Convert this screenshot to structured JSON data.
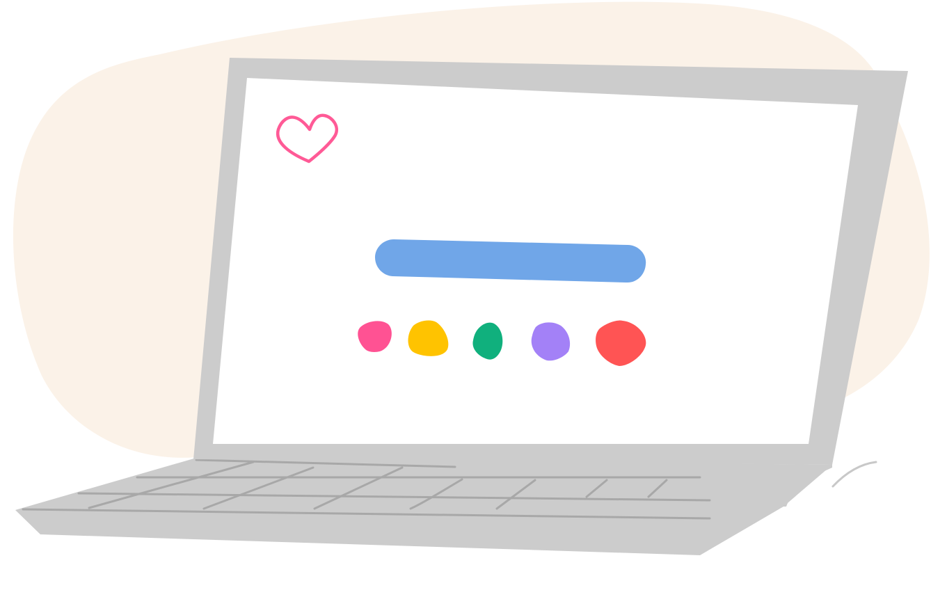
{
  "illustration": {
    "subject": "laptop",
    "icons": {
      "heart": "heart-icon",
      "search_bar": "search-bar-shape"
    },
    "colors": {
      "backdrop": "#FBF2E8",
      "laptop_body": "#CCCCCC",
      "screen": "#FFFFFF",
      "keyboard_lines": "#A8A8A8",
      "heart": "#FF5A96",
      "search_bar": "#70A6E8",
      "cord": "#C8C8C8"
    },
    "swatches": [
      {
        "name": "pink",
        "color": "#FF5293"
      },
      {
        "name": "yellow",
        "color": "#FFC300"
      },
      {
        "name": "green",
        "color": "#10B07D"
      },
      {
        "name": "purple",
        "color": "#A381F7"
      },
      {
        "name": "red",
        "color": "#FF5454"
      }
    ]
  }
}
